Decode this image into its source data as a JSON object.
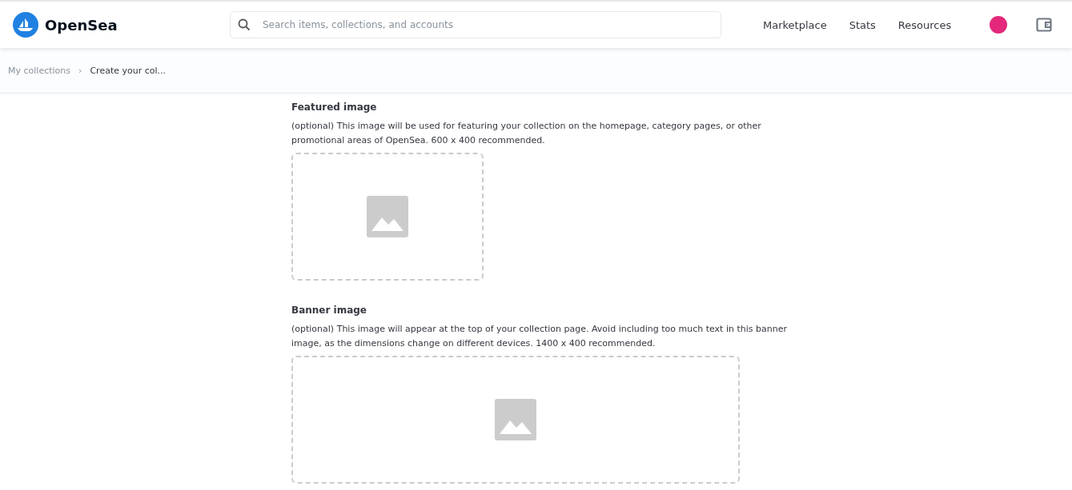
{
  "header": {
    "brand": "OpenSea",
    "search": {
      "placeholder": "Search items, collections, and accounts"
    },
    "nav": [
      "Marketplace",
      "Stats",
      "Resources"
    ]
  },
  "breadcrumb": [
    {
      "label": "My collections",
      "current": false
    },
    {
      "label": "Create your col...",
      "current": true
    }
  ],
  "breadcrumb_separator": "›",
  "sections": [
    {
      "kind": "featured",
      "title": "Featured image",
      "description": "(optional) This image will be used for featuring your collection on the homepage, category pages, or other promotional areas of OpenSea. 600 x 400 recommended."
    },
    {
      "kind": "banner",
      "title": "Banner image",
      "description": "(optional) This image will appear at the top of your collection page. Avoid including too much text in this banner image, as the dimensions change on different devices. 1400 x 400 recommended."
    }
  ]
}
